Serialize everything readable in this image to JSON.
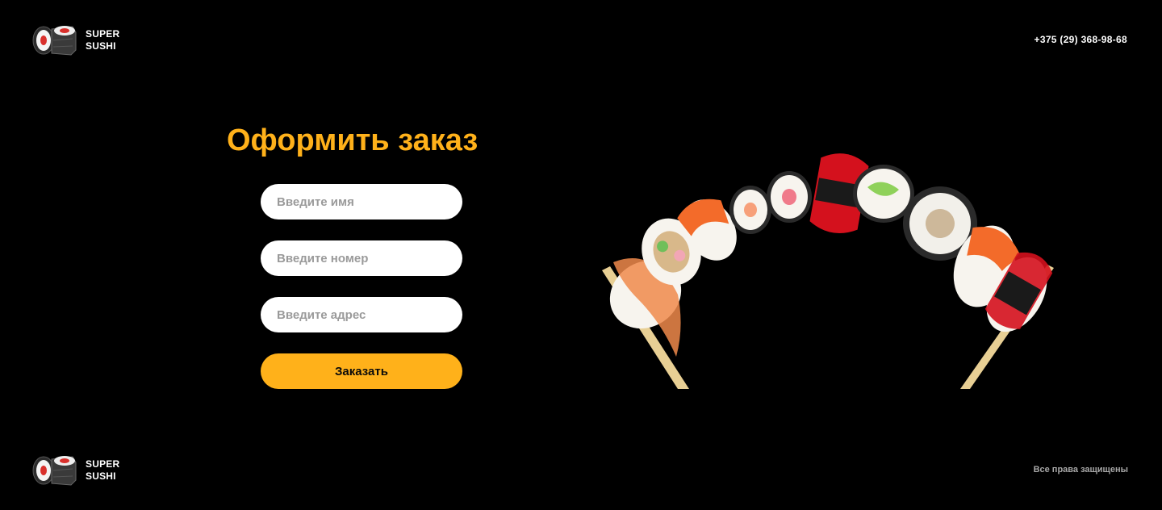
{
  "header": {
    "logo": {
      "line1": "SUPER",
      "line2": "SUSHI",
      "icon": "sushi-roll-icon"
    },
    "phone": "+375 (29) 368-98-68"
  },
  "order_form": {
    "title": "Оформить заказ",
    "name_placeholder": "Введите имя",
    "phone_placeholder": "Введите номер",
    "address_placeholder": "Введите адрес",
    "submit_label": "Заказать"
  },
  "hero_image": {
    "description_icon": "sushi-arc-on-chopsticks"
  },
  "footer": {
    "logo": {
      "line1": "SUPER",
      "line2": "SUSHI",
      "icon": "sushi-roll-icon"
    },
    "rights": "Все права защищены"
  },
  "colors": {
    "background": "#000000",
    "accent": "#ffb11a",
    "text": "#ffffff",
    "muted": "#a8a8a8"
  }
}
